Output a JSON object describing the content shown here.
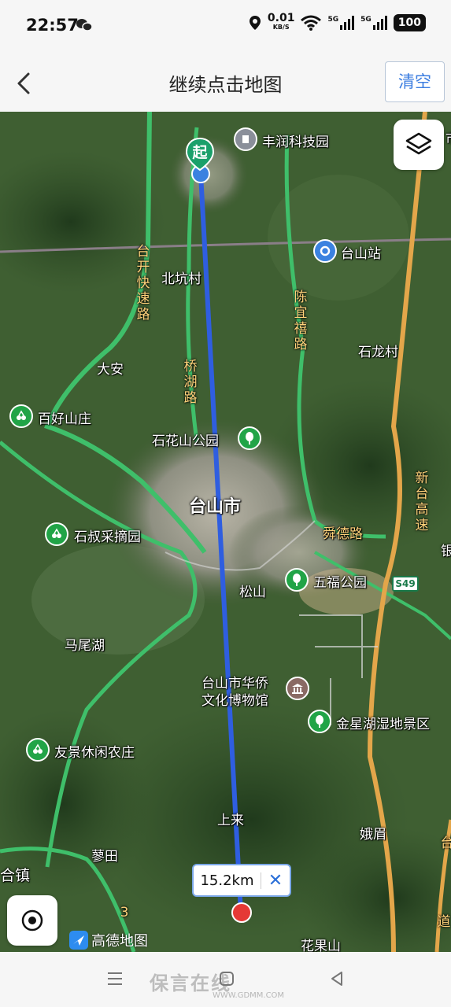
{
  "status": {
    "time": "22:57",
    "speed": "0.01",
    "speed_unit": "KB/S",
    "network1": "5G",
    "network2": "5G",
    "battery": "100"
  },
  "header": {
    "title": "继续点击地图",
    "clear_label": "清空"
  },
  "map": {
    "start_label": "起",
    "distance": "15.2km",
    "close_symbol": "✕",
    "logo_text": "高德地图",
    "city": "台山市",
    "places": {
      "fengrun": "丰润科技园",
      "taishan_station": "台山站",
      "beikeng": "北坑村",
      "shilong": "石龙村",
      "daan": "大安",
      "baihao": "百好山庄",
      "shihuashan": "石花山公园",
      "shishu": "石叔采摘园",
      "shundelu": "舜德路",
      "wufu": "五福公园",
      "songshan": "松山",
      "s49": "S49",
      "maweihu": "马尾湖",
      "museum_line1": "台山市华侨",
      "museum_line2": "文化博物馆",
      "jinxinghu": "金星湖湿地景区",
      "youjing": "友景休闲农庄",
      "shanglai": "上来",
      "emei": "娥眉",
      "liaotian": "蓼田",
      "hezhen": "合镇",
      "huaguoshan": "花果山",
      "edge_shi": "市",
      "edge_yin": "银"
    },
    "roads": {
      "taikai": "台开快速路",
      "qiaohu": "桥湖路",
      "chenyi": "陈宜禧路",
      "xintai": "新台高速",
      "edge_road1": "3",
      "edge_road2": "台",
      "edge_road3": "道"
    }
  },
  "footer": {
    "watermark": "保言在线",
    "watermark_url": "WWW.GDMM.COM"
  },
  "colors": {
    "route": "#2f5ee0",
    "road_green": "#3fbf6a",
    "road_orange": "#e3a64a",
    "accent": "#3b7de0",
    "end_marker": "#e53935"
  }
}
